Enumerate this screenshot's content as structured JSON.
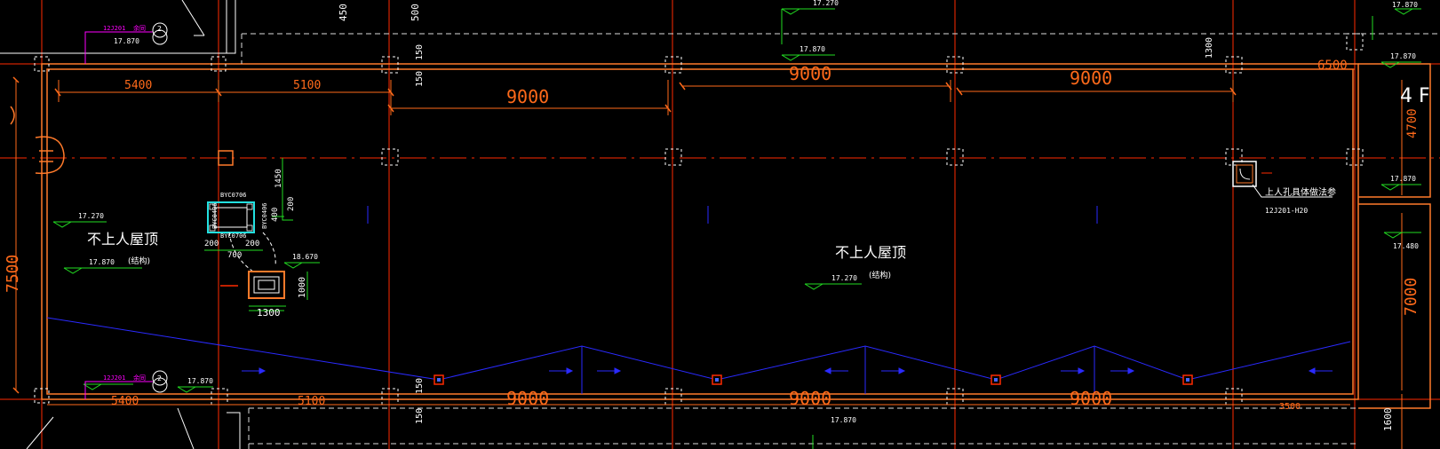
{
  "floor_label": "4 F",
  "roof_labels": {
    "left_title": "不上人屋顶",
    "center_title": "不上人屋顶",
    "structure_note_left": "(结构)",
    "structure_note_center": "(结构)"
  },
  "hatch_note": {
    "line1": "上人孔具体做法参",
    "line2": "12J201-H20"
  },
  "top_dimensions": [
    "5400",
    "5100",
    "9000",
    "9000",
    "9000",
    "6500"
  ],
  "bottom_dimensions": [
    "5400",
    "5100",
    "9000",
    "9000",
    "9000",
    "3500"
  ],
  "vertical_dimensions": {
    "left": "7500",
    "right_upper": "4700",
    "right_lower": "7000",
    "right_bottom": "1600",
    "top_small_a": "450",
    "top_small_b": "500",
    "top_small_c": "150",
    "top_small_d": "150",
    "top_small_e": "1300",
    "bottom_small_a": "150",
    "bottom_small_b": "150"
  },
  "elevations": {
    "e1": "17.270",
    "e2": "17.870",
    "e3": "17.870",
    "e4": "17.870",
    "e5": "17.270",
    "e6": "18.670",
    "e7": "17.270",
    "e8": "17.870",
    "e9": "17.870",
    "e10": "17.480",
    "e11": "17.870",
    "e12": "17.870",
    "e13": "17.870"
  },
  "vent_unit": {
    "label_top": "BYC0706",
    "label_bottom": "BYC0706",
    "label_left": "BYC0406",
    "label_right": "BYC0406",
    "dim_1450": "1450",
    "dim_200a": "200",
    "dim_400": "400",
    "dim_200b": "200",
    "dim_200c": "200",
    "dim_700": "700",
    "dim_1000": "1000",
    "dim_1300": "1300"
  },
  "detail_refs": {
    "ref_top": "12J201",
    "ref_top_word": "余同",
    "ref_top_num": "2",
    "ref_bottom": "12J201",
    "ref_bottom_word": "余同",
    "ref_bottom_num": "2"
  },
  "colors": {
    "background": "#000000",
    "axis_red": "#ff2a00",
    "wall_orange": "#ff7a2a",
    "dim_orange": "#ff6a1a",
    "slope_blue": "#2a2aff",
    "elevation_green": "#22dd22",
    "ref_magenta": "#ff00ff",
    "text_white": "#ffffff"
  }
}
